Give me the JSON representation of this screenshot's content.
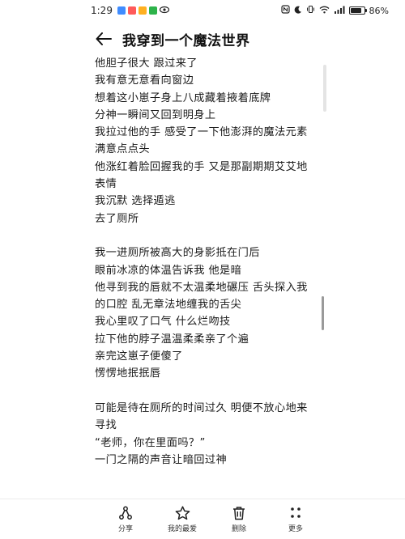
{
  "status": {
    "time": "1:29",
    "battery": "86%",
    "battery_level": 0.86
  },
  "header": {
    "title": "我穿到一个魔法世界"
  },
  "content": {
    "lines": [
      "他胆子很大 跟过来了",
      "我有意无意看向窗边",
      "想着这小崽子身上八成藏着掖着底牌",
      "分神一瞬间又回到明身上",
      "我拉过他的手 感受了一下他澎湃的魔法元素",
      "满意点点头",
      "他涨红着脸回握我的手 又是那副期期艾艾地",
      "表情",
      "我沉默 选择遁逃",
      "去了厕所",
      "",
      "我一进厕所被高大的身影抵在门后",
      "眼前冰凉的体温告诉我 他是暗",
      "他寻到我的唇就不太温柔地碾压 舌头探入我",
      "的口腔 乱无章法地缠我的舌尖",
      "我心里叹了口气 什么烂吻技",
      "拉下他的脖子温温柔柔亲了个遍",
      "亲完这崽子便傻了",
      "愣愣地抿抿唇",
      "",
      "可能是待在厕所的时间过久 明便不放心地来",
      "寻找",
      "“老师，你在里面吗？”",
      "一门之隔的声音让暗回过神"
    ]
  },
  "bottom_bar": {
    "share_label": "分享",
    "favorite_label": "我的最爱",
    "delete_label": "删除",
    "more_label": "更多"
  },
  "colors": {
    "text": "#1a1a1a",
    "background": "#ffffff",
    "app_icon_1": "#3f8cff",
    "app_icon_2": "#ff5a5a",
    "app_icon_3": "#ffb020",
    "app_icon_4": "#2db34a"
  }
}
